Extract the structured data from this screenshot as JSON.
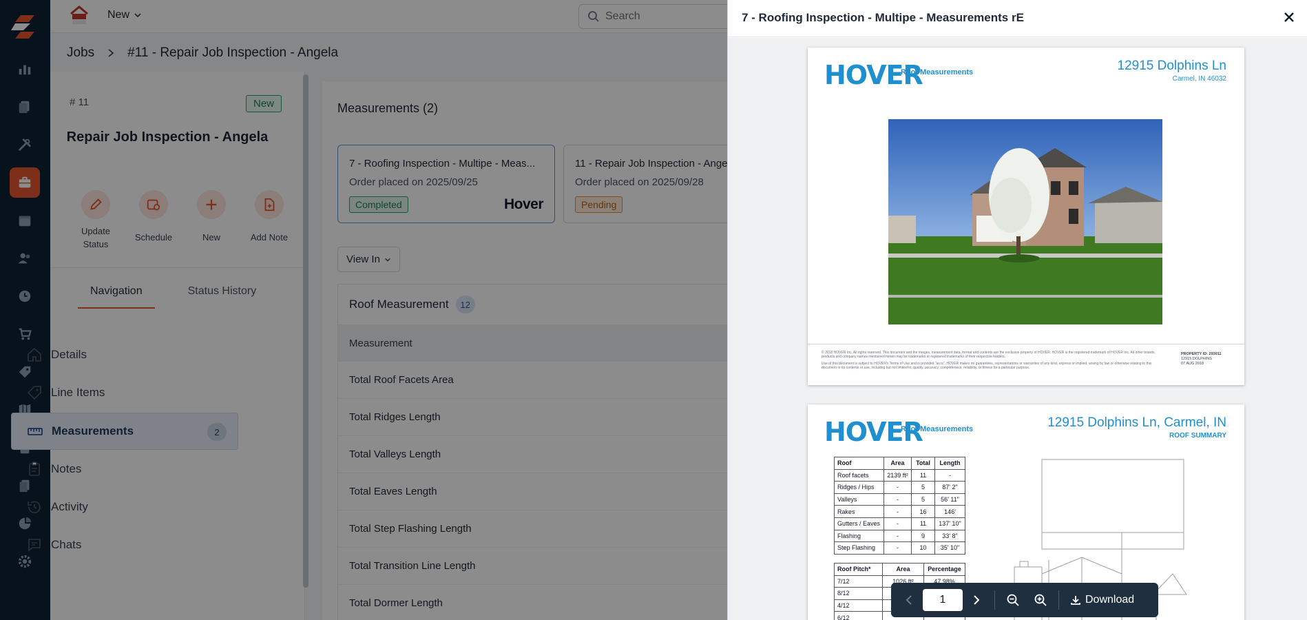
{
  "topbar": {
    "new_label": "New",
    "search_placeholder": "Search"
  },
  "breadcrumb": {
    "root": "Jobs",
    "current": "#11 - Repair Job Inspection - Angela"
  },
  "job": {
    "number": "# 11",
    "status": "New",
    "title": "Repair Job Inspection - Angela",
    "actions": [
      "Update Status",
      "Schedule",
      "New",
      "Add Note"
    ]
  },
  "tabs": {
    "navigation": "Navigation",
    "status_history": "Status History"
  },
  "nav": {
    "items": [
      {
        "label": "Details",
        "icon": "home-icon"
      },
      {
        "label": "Line Items",
        "icon": "tag-icon"
      },
      {
        "label": "Measurements",
        "icon": "ruler-icon",
        "count": "2"
      },
      {
        "label": "Notes",
        "icon": "clipboard-icon"
      },
      {
        "label": "Activity",
        "icon": "history-icon"
      },
      {
        "label": "Chats",
        "icon": "chat-icon"
      }
    ]
  },
  "measurements": {
    "title": "Measurements (2)",
    "orders": [
      {
        "title": "7 - Roofing Inspection - Multipe - Meas...",
        "date": "Order placed on 2025/09/25",
        "status": "Completed",
        "vendor": "Hover"
      },
      {
        "title": "11 - Repair Job Inspection - Ange",
        "date": "Order placed on 2025/09/28",
        "status": "Pending"
      }
    ],
    "view_in": "View In",
    "roof_title": "Roof Measurement",
    "roof_count": "12",
    "column": "Measurement",
    "rows": [
      "Total Roof Facets Area",
      "Total Ridges Length",
      "Total Valleys Length",
      "Total Eaves Length",
      "Total Step Flashing Length",
      "Total Transition Line Length",
      "Total Dormer Length"
    ]
  },
  "viewer": {
    "title": "7 - Roofing Inspection - Multipe - Measurements rE",
    "page1": {
      "brand": "HOVER",
      "subtitle": "Roof Measurements",
      "address": "12915 Dolphins Ln",
      "city": "Carmel, IN 46032",
      "fine_print": "© 2018 HOVER Inc. All rights reserved. This document and the images, measurement data, format and contents are the exclusive property of HOVER. HOVER is the registered trademark of HOVER Inc. All other brands, products and company names mentioned herein may be trademarks or registered trademarks of their respective holders.",
      "fine_print2": "Use of this document is subject to HOVER's Terms of Use and is provided \"as is\". HOVER makes no guarantees, representations or warranties of any kind, express or implied, arising by law or otherwise relating to this document or its contents or use, including but not limited to, quality, accuracy, completeness, reliability, or fitness for a particular purpose.",
      "property_id": "PROPERTY ID: 293011",
      "property_line2": "12915 DOLPHINS",
      "property_date": "07 AUG 2018"
    },
    "page2": {
      "brand": "HOVER",
      "subtitle": "Roof Measurements",
      "address": "12915 Dolphins Ln, Carmel, IN",
      "section": "ROOF SUMMARY",
      "summary_headers": [
        "Roof",
        "Area",
        "Total",
        "Length"
      ],
      "summary_rows": [
        [
          "Roof facets",
          "2139 ft²",
          "11",
          "-"
        ],
        [
          "Ridges / Hips",
          "-",
          "5",
          "87' 2\""
        ],
        [
          "Valleys",
          "-",
          "5",
          "56' 11\""
        ],
        [
          "Rakes",
          "-",
          "16",
          "146'"
        ],
        [
          "Gutters / Eaves",
          "-",
          "11",
          "137' 10\""
        ],
        [
          "Flashing",
          "-",
          "9",
          "33' 8\""
        ],
        [
          "Step Flashing",
          "-",
          "10",
          "35' 10\""
        ]
      ],
      "pitch_headers": [
        "Roof Pitch*",
        "Area",
        "Percentage"
      ],
      "pitch_rows": [
        [
          "7/12",
          "1026 ft²",
          "47.98%"
        ],
        [
          "8/12",
          "",
          ""
        ],
        [
          "4/12",
          "",
          ""
        ],
        [
          "6/12",
          "",
          ""
        ]
      ]
    },
    "pager": {
      "page": "1",
      "download": "Download"
    }
  },
  "colors": {
    "accent": "#e4572e",
    "rail": "#0f2233",
    "hover_blue": "#1f8fd0"
  }
}
